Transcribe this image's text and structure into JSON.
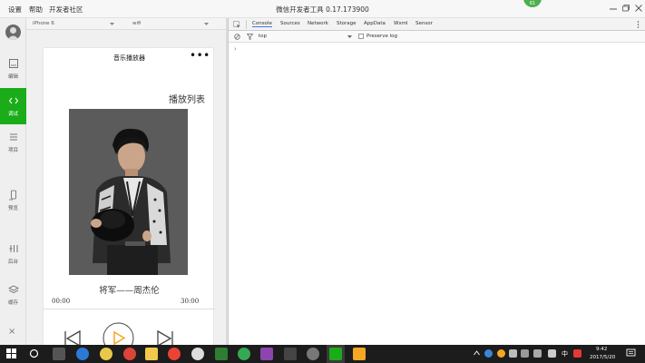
{
  "menubar": {
    "items": [
      "设置",
      "帮助",
      "开发者社区"
    ],
    "title": "微信开发者工具 0.17.173900",
    "badge": "61"
  },
  "sidebar": {
    "items": [
      {
        "label": "编辑",
        "icon": "code-file-icon",
        "active": false
      },
      {
        "label": "调试",
        "icon": "debug-icon",
        "active": true
      },
      {
        "label": "项目",
        "icon": "project-list-icon",
        "active": false
      },
      {
        "label": "预览",
        "icon": "phone-preview-icon",
        "active": false
      },
      {
        "label": "后台",
        "icon": "backend-icon",
        "active": false
      },
      {
        "label": "缓存",
        "icon": "layers-icon",
        "active": false
      }
    ],
    "close": "×"
  },
  "simulator": {
    "device": "iPhone 6",
    "network": "wifi",
    "nav_title": "音乐播放器",
    "nav_menu": "•••",
    "playlist_label": "播放列表",
    "song_title": "将军——周杰伦",
    "time_current": "00:00",
    "time_total": "30:00",
    "progress": 0
  },
  "devtools": {
    "tabs": [
      "Console",
      "Sources",
      "Network",
      "Storage",
      "AppData",
      "Wxml",
      "Sensor"
    ],
    "active_tab": "Console",
    "filter_context": "top",
    "preserve_log_label": "Preserve log",
    "prompt": "›"
  },
  "taskbar": {
    "time": "9:42",
    "date": "2017/5/20",
    "ime": "中",
    "colors": {
      "accent_green": "#1aad19",
      "play_orange": "#f5a623"
    }
  }
}
